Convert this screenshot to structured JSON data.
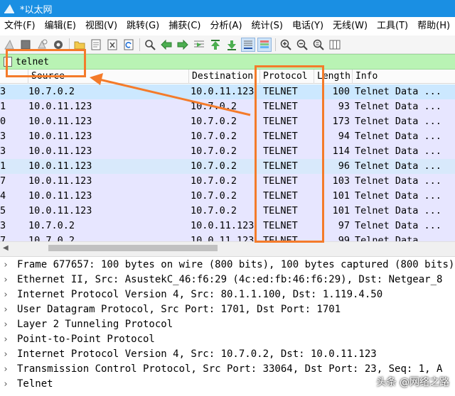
{
  "window": {
    "title": "*以太网"
  },
  "menu": [
    "文件(F)",
    "编辑(E)",
    "视图(V)",
    "跳转(G)",
    "捕获(C)",
    "分析(A)",
    "统计(S)",
    "电话(Y)",
    "无线(W)",
    "工具(T)",
    "帮助(H)"
  ],
  "toolbar": [
    "shark-fin-start",
    "stop-square",
    "restart-fin",
    "options-gear",
    "open-folder",
    "save-file",
    "close-x",
    "reload",
    "find-magnifier",
    "go-back-arrow",
    "go-forward-arrow",
    "go-to-packet",
    "go-first",
    "go-last",
    "auto-scroll",
    "colorize",
    "zoom-in",
    "zoom-out",
    "zoom-reset",
    "resize-columns"
  ],
  "filter": {
    "value": "telnet"
  },
  "columns": {
    "source": "Source",
    "destination": "Destination",
    "protocol": "Protocol",
    "length": "Length",
    "info": "Info"
  },
  "packets": [
    {
      "no": "3",
      "src": "10.7.0.2",
      "dst": "10.0.11.123",
      "proto": "TELNET",
      "len": "100",
      "info": "Telnet Data ..."
    },
    {
      "no": "1",
      "src": "10.0.11.123",
      "dst": "10.7.0.2",
      "proto": "TELNET",
      "len": "93",
      "info": "Telnet Data ..."
    },
    {
      "no": "0",
      "src": "10.0.11.123",
      "dst": "10.7.0.2",
      "proto": "TELNET",
      "len": "173",
      "info": "Telnet Data ..."
    },
    {
      "no": "3",
      "src": "10.0.11.123",
      "dst": "10.7.0.2",
      "proto": "TELNET",
      "len": "94",
      "info": "Telnet Data ..."
    },
    {
      "no": "3",
      "src": "10.0.11.123",
      "dst": "10.7.0.2",
      "proto": "TELNET",
      "len": "114",
      "info": "Telnet Data ..."
    },
    {
      "no": "1",
      "src": "10.0.11.123",
      "dst": "10.7.0.2",
      "proto": "TELNET",
      "len": "96",
      "info": "Telnet Data ..."
    },
    {
      "no": "7",
      "src": "10.0.11.123",
      "dst": "10.7.0.2",
      "proto": "TELNET",
      "len": "103",
      "info": "Telnet Data ..."
    },
    {
      "no": "4",
      "src": "10.0.11.123",
      "dst": "10.7.0.2",
      "proto": "TELNET",
      "len": "101",
      "info": "Telnet Data ..."
    },
    {
      "no": "5",
      "src": "10.0.11.123",
      "dst": "10.7.0.2",
      "proto": "TELNET",
      "len": "101",
      "info": "Telnet Data ..."
    },
    {
      "no": "3",
      "src": "10.7.0.2",
      "dst": "10.0.11.123",
      "proto": "TELNET",
      "len": "97",
      "info": "Telnet Data ..."
    },
    {
      "no": "7",
      "src": "10.7.0.2",
      "dst": "10.0.11.123",
      "proto": "TELNET",
      "len": "99",
      "info": "Telnet Data ..."
    }
  ],
  "details": [
    "Frame 677657: 100 bytes on wire (800 bits), 100 bytes captured (800 bits)",
    "Ethernet II, Src: AsustekC_46:f6:29 (4c:ed:fb:46:f6:29), Dst: Netgear_8",
    "Internet Protocol Version 4, Src: 80.1.1.100, Dst: 1.119.4.50",
    "User Datagram Protocol, Src Port: 1701, Dst Port: 1701",
    "Layer 2 Tunneling Protocol",
    "Point-to-Point Protocol",
    "Internet Protocol Version 4, Src: 10.7.0.2, Dst: 10.0.11.123",
    "Transmission Control Protocol, Src Port: 33064, Dst Port: 23, Seq: 1, A",
    "Telnet"
  ],
  "watermark": "头条 @网络之路",
  "colors": {
    "title_bar": "#1a8fe3",
    "filter_bar": "#b9f3b4",
    "selected_row": "#cce8ff",
    "row_lavender": "#e7e6ff",
    "annotation": "#f47b2a"
  }
}
